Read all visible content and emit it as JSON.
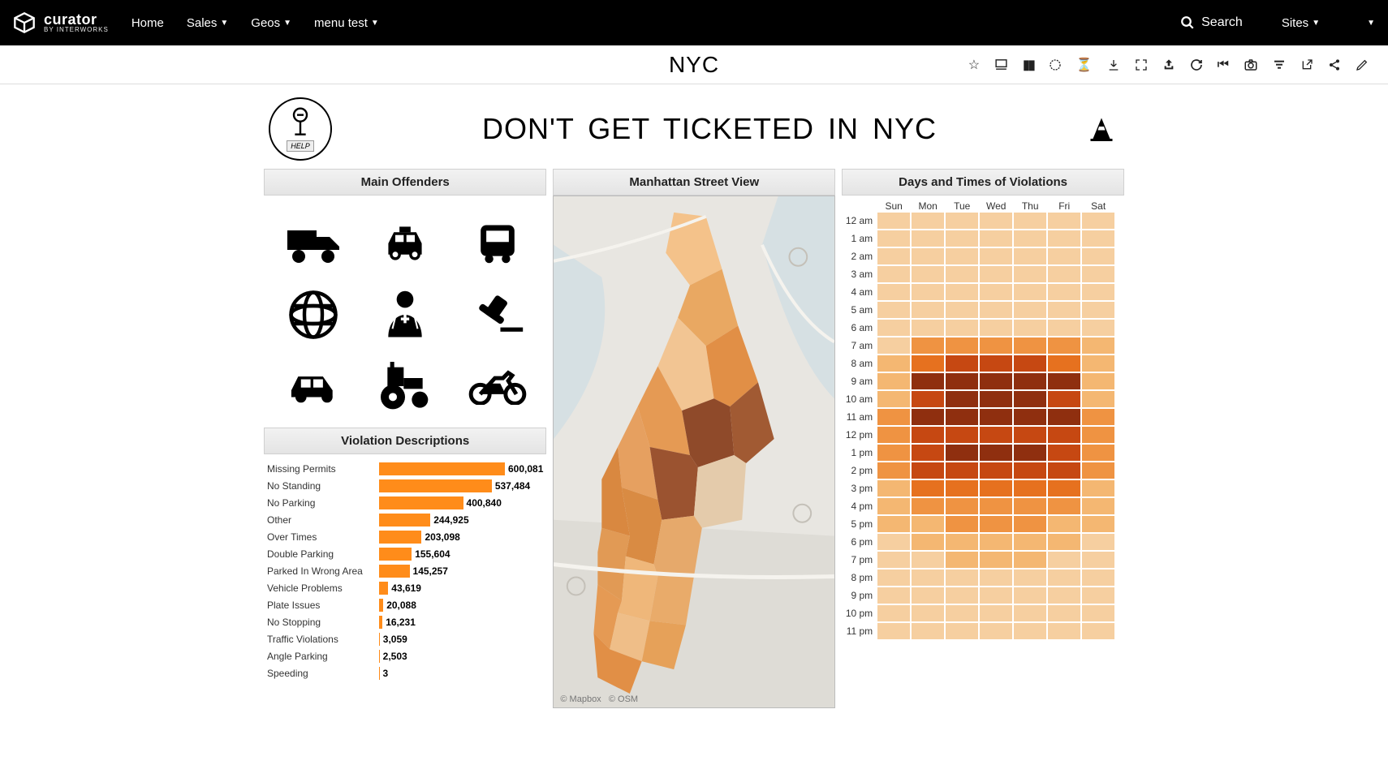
{
  "nav": {
    "brand": "curator",
    "brand_sub": "BY INTERWORKS",
    "items": [
      "Home",
      "Sales",
      "Geos",
      "menu test"
    ],
    "items_caret": [
      false,
      true,
      true,
      true
    ],
    "search_label": "Search",
    "sites_label": "Sites"
  },
  "subbar": {
    "title": "NYC"
  },
  "dashboard": {
    "help_label": "HELP",
    "title": "DON'T GET TICKETED IN NYC",
    "panel_offenders": "Main Offenders",
    "panel_map": "Manhattan Street View",
    "panel_heat": "Days and Times of Violations",
    "panel_violations": "Violation Descriptions",
    "map_credit_mapbox": "© Mapbox",
    "map_credit_osm": "© OSM"
  },
  "offenders": [
    "truck",
    "taxi",
    "bus",
    "globe",
    "doctor",
    "gavel",
    "car",
    "tractor",
    "motorcycle"
  ],
  "chart_data": [
    {
      "type": "bar",
      "title": "Violation Descriptions",
      "orientation": "horizontal",
      "xlim": [
        0,
        600081
      ],
      "categories": [
        "Missing Permits",
        "No Standing",
        "No Parking",
        "Other",
        "Over Times",
        "Double Parking",
        "Parked In Wrong Area",
        "Vehicle Problems",
        "Plate Issues",
        "No Stopping",
        "Traffic Violations",
        "Angle Parking",
        "Speeding"
      ],
      "values": [
        600081,
        537484,
        400840,
        244925,
        203098,
        155604,
        145257,
        43619,
        20088,
        16231,
        3059,
        2503,
        3
      ],
      "value_labels": [
        "600,081",
        "537,484",
        "400,840",
        "244,925",
        "203,098",
        "155,604",
        "145,257",
        "43,619",
        "20,088",
        "16,231",
        "3,059",
        "2,503",
        "3"
      ],
      "color": "#ff8c1a"
    },
    {
      "type": "heatmap",
      "title": "Days and Times of Violations",
      "x_categories": [
        "Sun",
        "Mon",
        "Tue",
        "Wed",
        "Thu",
        "Fri",
        "Sat"
      ],
      "y_categories": [
        "12 am",
        "1 am",
        "2 am",
        "3 am",
        "4 am",
        "5 am",
        "6 am",
        "7 am",
        "8 am",
        "9 am",
        "10 am",
        "11 am",
        "12 pm",
        "1 pm",
        "2 pm",
        "3 pm",
        "4 pm",
        "5 pm",
        "6 pm",
        "7 pm",
        "8 pm",
        "9 pm",
        "10 pm",
        "11 pm"
      ],
      "values": [
        [
          10,
          10,
          10,
          10,
          10,
          10,
          10
        ],
        [
          10,
          10,
          10,
          10,
          10,
          10,
          10
        ],
        [
          10,
          10,
          10,
          10,
          10,
          10,
          10
        ],
        [
          10,
          10,
          10,
          10,
          10,
          10,
          10
        ],
        [
          10,
          10,
          10,
          10,
          10,
          10,
          10
        ],
        [
          10,
          10,
          10,
          10,
          10,
          10,
          10
        ],
        [
          10,
          12,
          12,
          12,
          12,
          12,
          10
        ],
        [
          12,
          30,
          30,
          30,
          30,
          30,
          14
        ],
        [
          14,
          60,
          65,
          65,
          65,
          60,
          16
        ],
        [
          18,
          85,
          95,
          95,
          95,
          85,
          20
        ],
        [
          18,
          80,
          90,
          90,
          90,
          80,
          20
        ],
        [
          22,
          85,
          95,
          95,
          95,
          85,
          22
        ],
        [
          22,
          70,
          80,
          80,
          80,
          70,
          22
        ],
        [
          22,
          75,
          85,
          85,
          85,
          75,
          22
        ],
        [
          22,
          70,
          80,
          80,
          80,
          70,
          22
        ],
        [
          20,
          45,
          50,
          50,
          50,
          45,
          20
        ],
        [
          18,
          30,
          32,
          32,
          32,
          30,
          18
        ],
        [
          14,
          20,
          22,
          22,
          22,
          20,
          14
        ],
        [
          12,
          15,
          16,
          16,
          16,
          15,
          12
        ],
        [
          12,
          12,
          13,
          13,
          13,
          12,
          12
        ],
        [
          10,
          10,
          11,
          11,
          11,
          10,
          10
        ],
        [
          10,
          10,
          10,
          10,
          10,
          10,
          10
        ],
        [
          10,
          10,
          10,
          10,
          10,
          10,
          10
        ],
        [
          10,
          10,
          10,
          10,
          10,
          10,
          10
        ]
      ],
      "color_scale": [
        "#f6cfa0",
        "#f4b772",
        "#ef9342",
        "#e6711f",
        "#c64812",
        "#8f2f0f"
      ]
    }
  ]
}
